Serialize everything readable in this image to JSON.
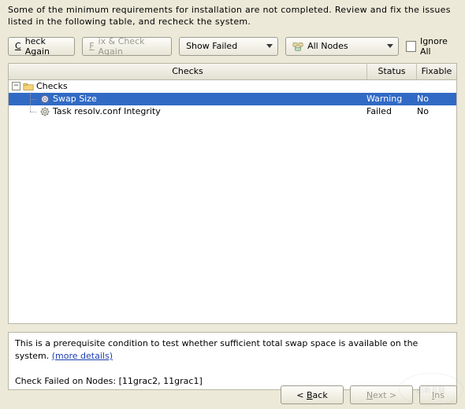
{
  "intro": "Some of the minimum requirements for installation are not completed. Review and fix the issues listed in the following table, and recheck the system.",
  "toolbar": {
    "check_again_pre": "C",
    "check_again_post": "heck Again",
    "fix_check_pre": "F",
    "fix_check_post": "ix & Check Again",
    "show_failed": "Show Failed",
    "all_nodes": "All Nodes",
    "ignore_pre": "I",
    "ignore_post": "gnore All"
  },
  "columns": {
    "checks": "Checks",
    "status": "Status",
    "fixable": "Fixable"
  },
  "tree": {
    "root": "Checks",
    "rows": [
      {
        "label": "Swap Size",
        "status": "Warning",
        "fixable": "No",
        "selected": true
      },
      {
        "label": "Task resolv.conf Integrity",
        "status": "Failed",
        "fixable": "No",
        "selected": false
      }
    ]
  },
  "detail": {
    "text": "This is a prerequisite condition to test whether sufficient total swap space is available on the system. ",
    "more": "(more details)",
    "failed_prefix": "Check Failed on Nodes: ",
    "failed_nodes": "[11grac2, 11grac1]"
  },
  "nav": {
    "back": "< Back",
    "next": "N",
    "next2": "ext >",
    "install_pre": "I",
    "install_post": "ns"
  },
  "watermark": "创新互联"
}
